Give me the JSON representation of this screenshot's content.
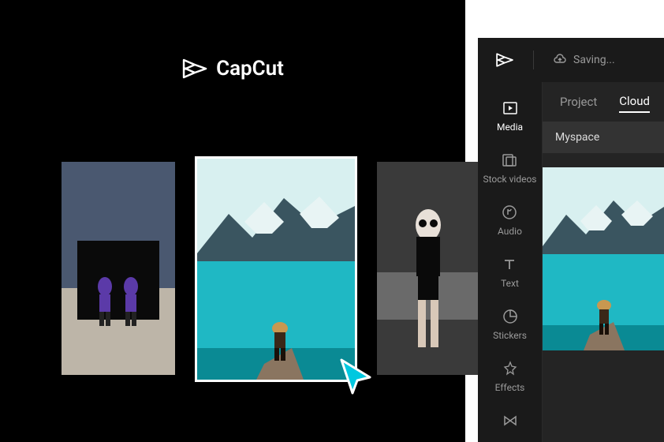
{
  "app": {
    "logo_text": "CapCut"
  },
  "side": {
    "saving_label": "Saving...",
    "rail": [
      {
        "label": "Media",
        "icon": "media-icon",
        "active": true
      },
      {
        "label": "Stock videos",
        "icon": "stock-icon",
        "active": false
      },
      {
        "label": "Audio",
        "icon": "audio-icon",
        "active": false
      },
      {
        "label": "Text",
        "icon": "text-icon",
        "active": false
      },
      {
        "label": "Stickers",
        "icon": "stickers-icon",
        "active": false
      },
      {
        "label": "Effects",
        "icon": "effects-icon",
        "active": false
      },
      {
        "label": "",
        "icon": "transitions-icon",
        "active": false
      }
    ],
    "tabs": [
      {
        "label": "Project",
        "active": false
      },
      {
        "label": "Cloud",
        "active": true
      }
    ],
    "space_label": "Myspace"
  },
  "gallery": {
    "items": [
      {
        "id": "photo-1",
        "selected": false
      },
      {
        "id": "photo-2",
        "selected": true
      },
      {
        "id": "photo-3",
        "selected": false
      }
    ]
  },
  "colors": {
    "accent": "#00c8e0"
  }
}
